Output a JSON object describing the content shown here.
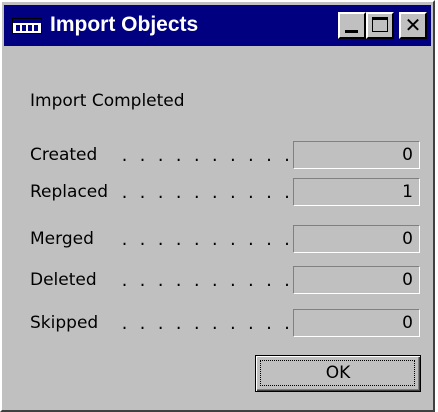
{
  "window": {
    "title": "Import Objects",
    "controls": {
      "minimize_icon": "minimize-icon",
      "maximize_icon": "maximize-icon",
      "close_icon": "close-icon",
      "close_glyph": "✕"
    },
    "colors": {
      "titlebar": "#000080",
      "face": "#c0c0c0"
    }
  },
  "dialog": {
    "heading": "Import Completed",
    "dots": ". . . . . . . . . .",
    "rows": [
      {
        "label": "Created",
        "value": "0"
      },
      {
        "label": "Replaced",
        "value": "1"
      },
      {
        "label": "Merged",
        "value": "0"
      },
      {
        "label": "Deleted",
        "value": "0"
      },
      {
        "label": "Skipped",
        "value": "0"
      }
    ],
    "ok_label": "OK"
  }
}
